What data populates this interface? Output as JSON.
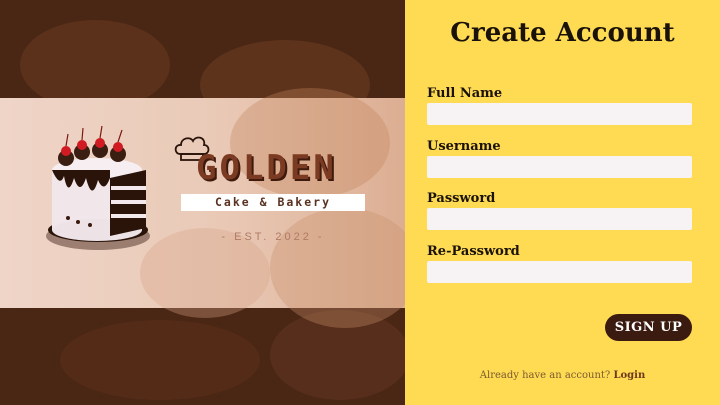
{
  "brand": {
    "title": "GOLDEN",
    "subtitle": "Cake & Bakery",
    "established": "- EST. 2022 -"
  },
  "form": {
    "title": "Create Account",
    "fields": [
      {
        "label": "Full Name",
        "value": ""
      },
      {
        "label": "Username",
        "value": ""
      },
      {
        "label": "Password",
        "value": ""
      },
      {
        "label": "Re-Password",
        "value": ""
      }
    ],
    "submit_label": "SIGN UP",
    "footer_prompt": "Already have an account?",
    "footer_link": "Login"
  },
  "colors": {
    "form_background": "#ffda53",
    "brand_dark": "#4a2614",
    "button": "#3b1a0f"
  },
  "icons": {
    "logo": "chef-hat-icon",
    "illustration": "cake-image"
  }
}
